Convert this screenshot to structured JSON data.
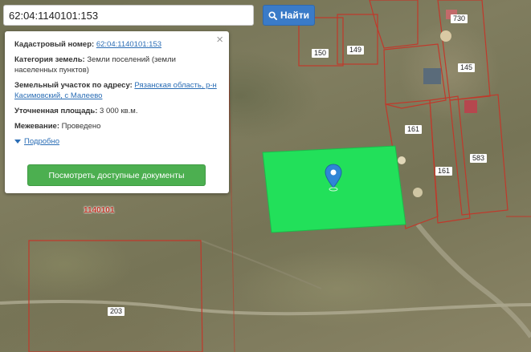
{
  "search": {
    "value": "62:04:1140101:153",
    "button_label": "Найти"
  },
  "popup": {
    "cadastral_label": "Кадастровый номер:",
    "cadastral_value": "62:04:1140101:153",
    "category_label": "Категория земель:",
    "category_value": "Земли поселений (земли населенных пунктов)",
    "address_label": "Земельный участок по адресу:",
    "address_value": "Рязанская область, р-н Касимовский, с Малеево",
    "area_label": "Уточненная площадь:",
    "area_value": "3 000 кв.м.",
    "survey_label": "Межевание:",
    "survey_value": "Проведено",
    "more_label": "Подробно",
    "docs_button_label": "Посмотреть доступные документы",
    "close_glyph": "×"
  },
  "map": {
    "quarter_label": "1140101",
    "parcel_labels": [
      "150",
      "149",
      "145",
      "161",
      "161",
      "583",
      "203",
      "730"
    ],
    "colors": {
      "boundary": "#c0392b",
      "selected_fill": "#22e05a",
      "pin": "#2f86d6"
    }
  }
}
